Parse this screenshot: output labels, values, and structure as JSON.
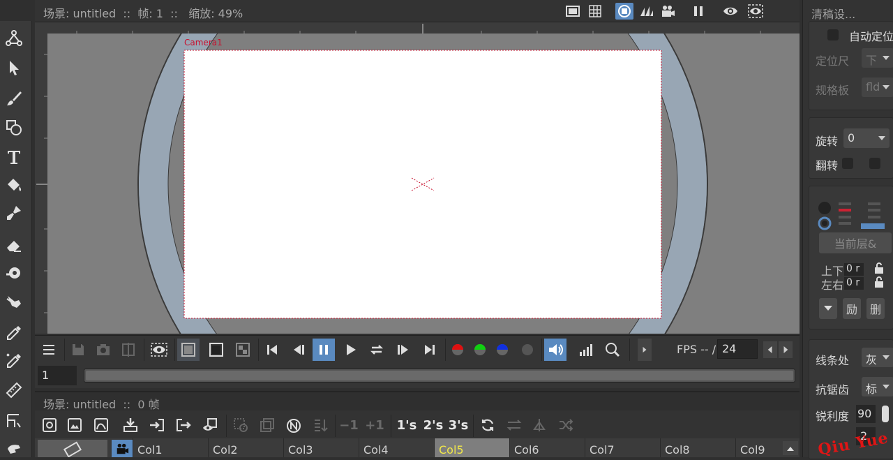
{
  "viewer": {
    "info": "场景: untitled  ::  帧: 1  ::   缩放: 49%",
    "camera_label": "Camera1"
  },
  "playbar": {
    "fps_label": "FPS -- /",
    "fps_value": "24"
  },
  "frame": {
    "value": "1"
  },
  "xsheet": {
    "info": "场景: untitled  ::  0 帧",
    "step_buttons": [
      "1's",
      "2's",
      "3's"
    ],
    "minus_label": "−1",
    "plus_label": "+1",
    "columns": [
      "Col1",
      "Col2",
      "Col3",
      "Col4",
      "Col5",
      "Col6",
      "Col7",
      "Col8",
      "Col9"
    ],
    "active_column": "Col5"
  },
  "right_panel": {
    "title": "清稿设...",
    "auto_pos_label": "自动定位",
    "peg_label": "定位尺",
    "peg_value": "下",
    "field_label": "规格板",
    "field_value": "fld",
    "rotate_label": "旋转",
    "rotate_value": "0",
    "flip_label": "翻转",
    "current_layer_label": "当前层&",
    "top_bottom_label": "上下",
    "left_right_label": "左右",
    "offset_tb": "0 r",
    "offset_lr": "0 r",
    "btn_add": "励",
    "btn_del": "删",
    "line_proc_label": "线条处",
    "line_proc_value": "灰",
    "antialias_label": "抗锯齿",
    "antialias_value": "标",
    "sharp_label": "锐利度",
    "sharp_value": "90",
    "extra_value": "2"
  },
  "watermark": "Qiu Yue",
  "colors": {
    "accent": "#5a8ac0",
    "active_column_text": "#f1e84a",
    "camera_border": "#c8102e",
    "ring": "#98a6b4"
  }
}
